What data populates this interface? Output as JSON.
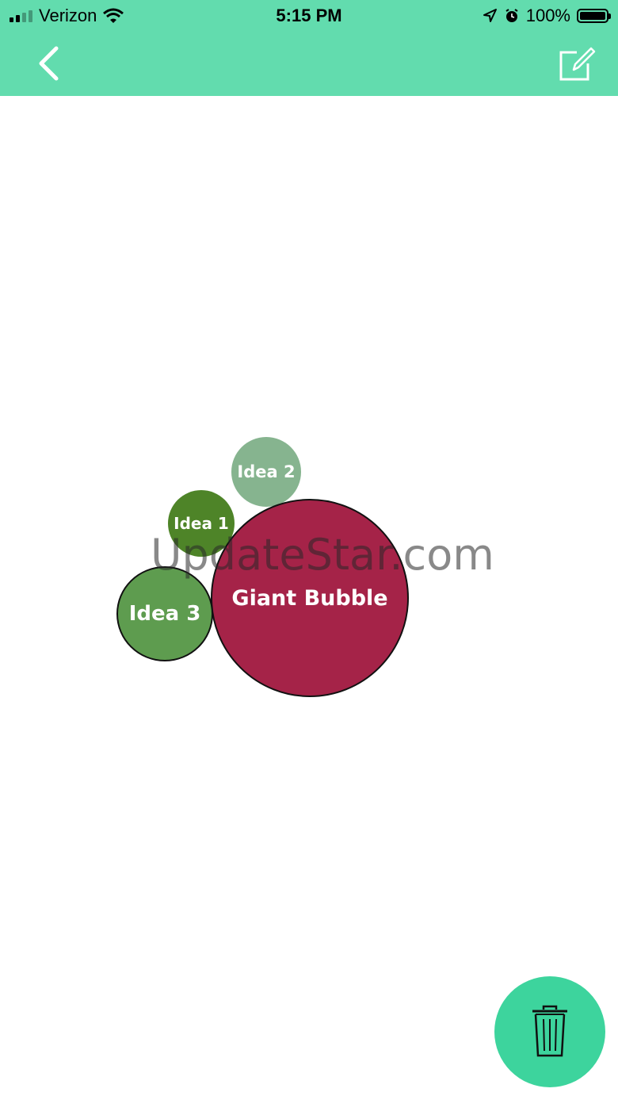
{
  "status_bar": {
    "carrier": "Verizon",
    "time": "5:15 PM",
    "battery": "100%"
  },
  "header": {
    "back_icon": "chevron-left-icon",
    "edit_icon": "compose-icon",
    "color": "#62dcae"
  },
  "bubbles": [
    {
      "label": "Idea 2",
      "color": "#86b48f"
    },
    {
      "label": "Idea 1",
      "color": "#4e8428"
    },
    {
      "label": "Idea 3",
      "color": "#5e9c4f"
    },
    {
      "label": "Giant Bubble",
      "color": "#a52348"
    }
  ],
  "watermark": "UpdateStar.com",
  "fab": {
    "icon": "trash-icon",
    "color": "#3dd49d"
  }
}
